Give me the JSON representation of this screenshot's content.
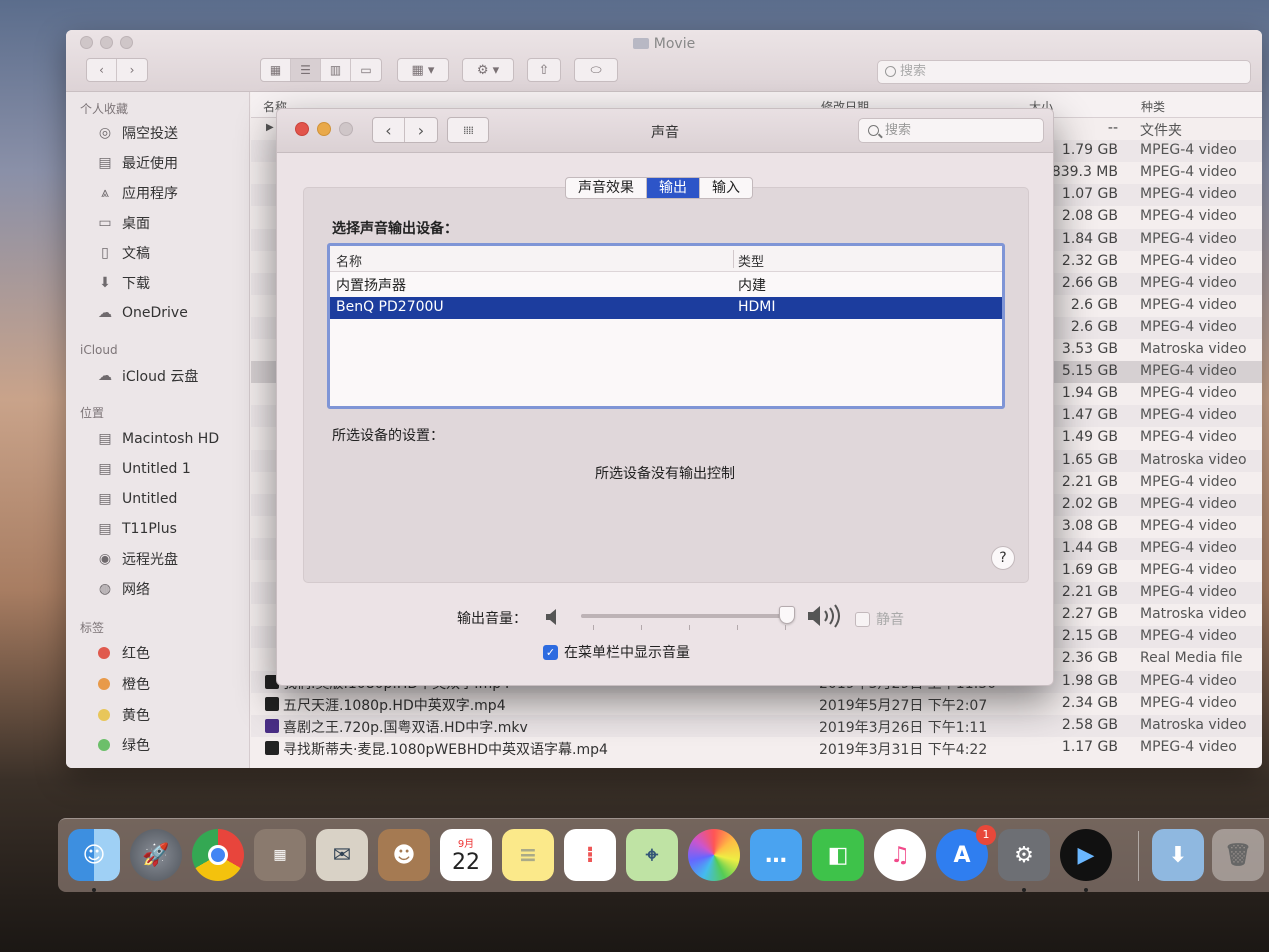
{
  "finder": {
    "title": "Movie",
    "search_placeholder": "搜索",
    "sidebar": {
      "favorites_header": "个人收藏",
      "favorites": [
        "隔空投送",
        "最近使用",
        "应用程序",
        "桌面",
        "文稿",
        "下载",
        "OneDrive"
      ],
      "icloud_header": "iCloud",
      "icloud": [
        "iCloud 云盘"
      ],
      "locations_header": "位置",
      "locations": [
        "Macintosh HD",
        "Untitled 1",
        "Untitled",
        "T11Plus",
        "远程光盘",
        "网络"
      ],
      "tags_header": "标签",
      "tags": [
        {
          "label": "红色",
          "color": "#e05a4e"
        },
        {
          "label": "橙色",
          "color": "#e89a4a"
        },
        {
          "label": "黄色",
          "color": "#e8c65a"
        },
        {
          "label": "绿色",
          "color": "#6cbf6a"
        }
      ]
    },
    "columns": {
      "name": "名称",
      "modified": "修改日期",
      "size": "大小",
      "kind": "种类"
    },
    "rows": [
      {
        "name": "",
        "date": "",
        "size": "--",
        "kind": "文件夹"
      },
      {
        "name": "",
        "date": "",
        "size": "1.79 GB",
        "kind": "MPEG-4 video"
      },
      {
        "name": "",
        "date": "",
        "size": "839.3 MB",
        "kind": "MPEG-4 video"
      },
      {
        "name": "",
        "date": "",
        "size": "1.07 GB",
        "kind": "MPEG-4 video"
      },
      {
        "name": "",
        "date": "",
        "size": "2.08 GB",
        "kind": "MPEG-4 video"
      },
      {
        "name": "",
        "date": "",
        "size": "1.84 GB",
        "kind": "MPEG-4 video"
      },
      {
        "name": "",
        "date": "",
        "size": "2.32 GB",
        "kind": "MPEG-4 video"
      },
      {
        "name": "",
        "date": "",
        "size": "2.66 GB",
        "kind": "MPEG-4 video"
      },
      {
        "name": "",
        "date": "",
        "size": "2.6 GB",
        "kind": "MPEG-4 video"
      },
      {
        "name": "",
        "date": "",
        "size": "2.6 GB",
        "kind": "MPEG-4 video"
      },
      {
        "name": "",
        "date": "",
        "size": "3.53 GB",
        "kind": "Matroska video"
      },
      {
        "name": "",
        "date": "",
        "size": "5.15 GB",
        "kind": "MPEG-4 video"
      },
      {
        "name": "",
        "date": "",
        "size": "1.94 GB",
        "kind": "MPEG-4 video"
      },
      {
        "name": "",
        "date": "",
        "size": "1.47 GB",
        "kind": "MPEG-4 video"
      },
      {
        "name": "",
        "date": "",
        "size": "1.49 GB",
        "kind": "MPEG-4 video"
      },
      {
        "name": "",
        "date": "",
        "size": "1.65 GB",
        "kind": "Matroska video"
      },
      {
        "name": "",
        "date": "",
        "size": "2.21 GB",
        "kind": "MPEG-4 video"
      },
      {
        "name": "",
        "date": "",
        "size": "2.02 GB",
        "kind": "MPEG-4 video"
      },
      {
        "name": "",
        "date": "",
        "size": "3.08 GB",
        "kind": "MPEG-4 video"
      },
      {
        "name": "",
        "date": "",
        "size": "1.44 GB",
        "kind": "MPEG-4 video"
      },
      {
        "name": "",
        "date": "",
        "size": "1.69 GB",
        "kind": "MPEG-4 video"
      },
      {
        "name": "",
        "date": "",
        "size": "2.21 GB",
        "kind": "MPEG-4 video"
      },
      {
        "name": "",
        "date": "",
        "size": "2.27 GB",
        "kind": "Matroska video"
      },
      {
        "name": "",
        "date": "",
        "size": "2.15 GB",
        "kind": "MPEG-4 video"
      },
      {
        "name": "",
        "date": "",
        "size": "2.36 GB",
        "kind": "Real Media file"
      },
      {
        "name": "我们.美版.1080p.HD中英双字.mp4",
        "date": "2019年3月29日 上午11:50",
        "size": "1.98 GB",
        "kind": "MPEG-4 video"
      },
      {
        "name": "五尺天涯.1080p.HD中英双字.mp4",
        "date": "2019年5月27日 下午2:07",
        "size": "2.34 GB",
        "kind": "MPEG-4 video"
      },
      {
        "name": "喜剧之王.720p.国粤双语.HD中字.mkv",
        "date": "2019年3月26日 下午1:11",
        "size": "2.58 GB",
        "kind": "Matroska video"
      },
      {
        "name": "寻找斯蒂夫·麦昆.1080pWEBHD中英双语字幕.mp4",
        "date": "2019年3月31日 下午4:22",
        "size": "1.17 GB",
        "kind": "MPEG-4 video"
      }
    ]
  },
  "prefs": {
    "title": "声音",
    "search_placeholder": "搜索",
    "tabs": [
      {
        "label": "声音效果",
        "active": false
      },
      {
        "label": "输出",
        "active": true
      },
      {
        "label": "输入",
        "active": false
      }
    ],
    "select_label": "选择声音输出设备：",
    "col_name": "名称",
    "col_type": "类型",
    "devices": [
      {
        "name": "内置扬声器",
        "type": "内建",
        "selected": false
      },
      {
        "name": "BenQ PD2700U",
        "type": "HDMI",
        "selected": true
      }
    ],
    "settings_label": "所选设备的设置：",
    "no_controls": "所选设备没有输出控制",
    "help": "?",
    "volume_label": "输出音量：",
    "volume_level": 0.98,
    "mute_label": "静音",
    "mute_checked": false,
    "show_volume_label": "在菜单栏中显示音量",
    "show_volume_checked": true
  },
  "dock": {
    "calendar_month": "9月",
    "calendar_day": "22",
    "appstore_badge": "1",
    "icons": [
      "finder-icon",
      "launchpad-icon",
      "chrome-icon",
      "calculator-icon",
      "mail-icon",
      "contacts-icon",
      "calendar-icon",
      "notes-icon",
      "reminders-icon",
      "maps-icon",
      "photos-icon",
      "messages-icon",
      "facetime-icon",
      "itunes-icon",
      "app-store-icon",
      "system-preferences-icon",
      "media-player-icon",
      "downloads-folder-icon",
      "trash-icon"
    ],
    "colors": {
      "finder": "#3d8fe0",
      "chrome": "#e8453c",
      "itunes": "#f14a8a",
      "appstore": "#2f7ef0",
      "facetime": "#3ec24a"
    }
  }
}
